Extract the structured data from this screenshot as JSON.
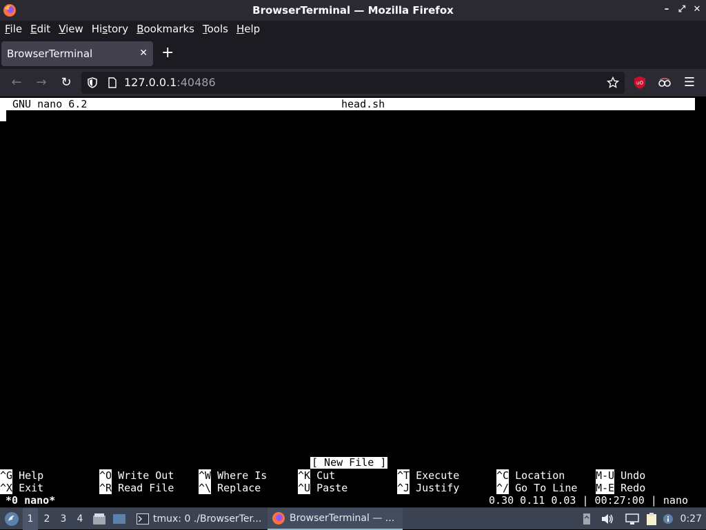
{
  "window": {
    "title": "BrowserTerminal — Mozilla Firefox",
    "controls": [
      "–",
      "⤢",
      "✕"
    ]
  },
  "menubar": {
    "items": [
      {
        "label": "File",
        "accel": "F",
        "rest": "ile"
      },
      {
        "label": "Edit",
        "accel": "E",
        "rest": "dit"
      },
      {
        "label": "View",
        "accel": "V",
        "rest": "iew"
      },
      {
        "label": "History",
        "accel": "s",
        "pre": "Hi",
        "rest": "tory"
      },
      {
        "label": "Bookmarks",
        "accel": "B",
        "rest": "ookmarks"
      },
      {
        "label": "Tools",
        "accel": "T",
        "rest": "ools"
      },
      {
        "label": "Help",
        "accel": "H",
        "rest": "elp"
      }
    ]
  },
  "tabs": [
    {
      "label": "BrowserTerminal",
      "active": true
    }
  ],
  "navbar": {
    "url_host": "127.0.0.1",
    "url_port": ":40486"
  },
  "nano": {
    "version": "GNU nano 6.2",
    "filename": "head.sh",
    "status_message": "[ New File ]",
    "shortcuts_row1": [
      {
        "key": "^G",
        "label": "Help"
      },
      {
        "key": "^O",
        "label": "Write Out"
      },
      {
        "key": "^W",
        "label": "Where Is"
      },
      {
        "key": "^K",
        "label": "Cut"
      },
      {
        "key": "^T",
        "label": "Execute"
      },
      {
        "key": "^C",
        "label": "Location"
      },
      {
        "key": "M-U",
        "label": "Undo"
      }
    ],
    "shortcuts_row2": [
      {
        "key": "^X",
        "label": "Exit"
      },
      {
        "key": "^R",
        "label": "Read File"
      },
      {
        "key": "^\\",
        "label": "Replace"
      },
      {
        "key": "^U",
        "label": "Paste"
      },
      {
        "key": "^J",
        "label": "Justify"
      },
      {
        "key": "^/",
        "label": "Go To Line"
      },
      {
        "key": "M-E",
        "label": "Redo"
      }
    ]
  },
  "tmux": {
    "window_label": "*0 nano*",
    "right_status": "0.30 0.11 0.03 | 00:27:00 | nano"
  },
  "taskbar": {
    "workspaces": [
      "1",
      "2",
      "3",
      "4"
    ],
    "active_workspace": "1",
    "tasks": [
      {
        "label": "tmux: 0 ./BrowserTer...",
        "icon": "terminal-icon",
        "active": false
      },
      {
        "label": "BrowserTerminal — ...",
        "icon": "firefox-icon",
        "active": true
      }
    ],
    "clock": "0:27"
  },
  "colors": {
    "titlebar_bg": "#2b2a33",
    "toolbar_bg": "#1c1b22",
    "tab_active_bg": "#42414d",
    "terminal_bg": "#000000",
    "taskbar_bg": "#3b4252",
    "ublock_red": "#c8102e"
  }
}
